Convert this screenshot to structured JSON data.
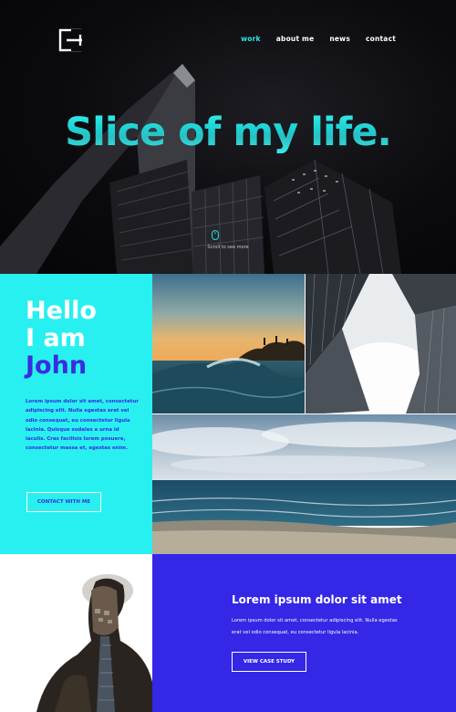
{
  "nav": {
    "items": [
      {
        "label": "work",
        "active": true
      },
      {
        "label": "about me",
        "active": false
      },
      {
        "label": "news",
        "active": false
      },
      {
        "label": "contact",
        "active": false
      }
    ]
  },
  "logo": {
    "icon": "monogram-e-logo"
  },
  "hero": {
    "title": "Slice of my life.",
    "scroll_hint": "Scroll to see more",
    "scroll_icon": "mouse-icon"
  },
  "intro": {
    "greeting_line1": "Hello",
    "greeting_line2": "I am",
    "name": "John",
    "body": "Lorem ipsum dolor sit amet, consectetur adipiscing elit. Nulla egestas erat vel odio consequat, eu consectetur ligula lacinia. Quisque sodales a urna id iaculis. Cras facilisis lorem posuere, consectetur massa et, egestas enim.",
    "contact_button": "CONTACT WITH ME"
  },
  "case_study": {
    "title": "Lorem ipsum dolor sit amet",
    "body": "Lorem ipsum dolor sit amet, consectetur adipiscing elit. Nulla egestas erat vel odio consequat, eu consectetur ligula lacinia.",
    "button": "VIEW CASE STUDY"
  },
  "colors": {
    "accent_cyan": "#28f0f0",
    "accent_blue": "#3427e6",
    "hero_bg": "#0b0b0e"
  }
}
